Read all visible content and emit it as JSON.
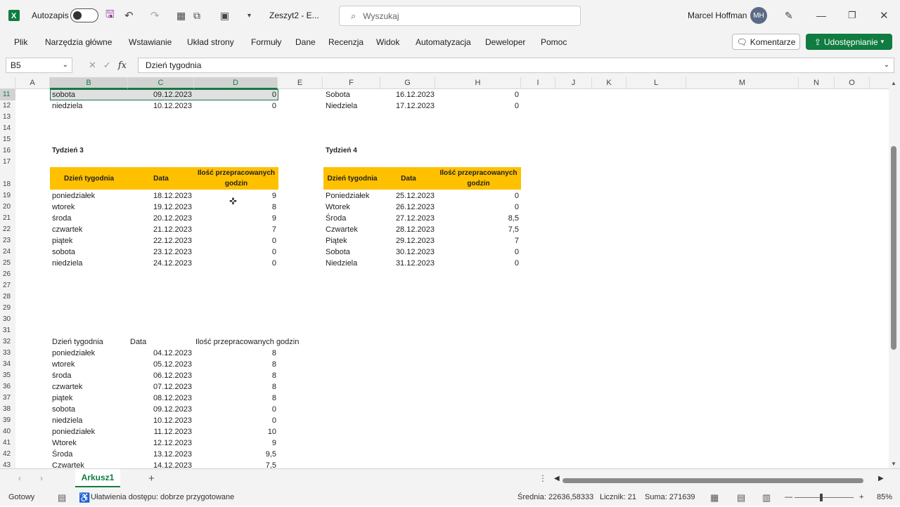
{
  "titlebar": {
    "autosave": "Autozapis",
    "filename": "Zeszyt2 - E...",
    "search_placeholder": "Wyszukaj",
    "user": "Marcel Hoffman",
    "initials": "MH"
  },
  "menu": [
    "Plik",
    "Narzędzia główne",
    "Wstawianie",
    "Układ strony",
    "Formuły",
    "Dane",
    "Recenzja",
    "Widok",
    "Automatyzacja",
    "Deweloper",
    "Pomoc"
  ],
  "buttons": {
    "comments": "Komentarze",
    "share": "Udostępnianie"
  },
  "formula": {
    "namebox": "B5",
    "fx": "fx",
    "value": "Dzień tygodnia"
  },
  "columns": [
    "A",
    "B",
    "C",
    "D",
    "E",
    "F",
    "G",
    "H",
    "I",
    "J",
    "K",
    "L",
    "M",
    "N",
    "O"
  ],
  "rows": [
    "11",
    "12",
    "13",
    "14",
    "15",
    "16",
    "17",
    "18",
    "19",
    "20",
    "21",
    "22",
    "23",
    "24",
    "25",
    "26",
    "27",
    "28",
    "29",
    "30",
    "31",
    "32",
    "33",
    "34",
    "35",
    "36",
    "37",
    "38",
    "39",
    "40",
    "41",
    "42",
    "43"
  ],
  "top_rows": {
    "left": [
      [
        "sobota",
        "09.12.2023",
        "0"
      ],
      [
        "niedziela",
        "10.12.2023",
        "0"
      ]
    ],
    "right": [
      [
        "Sobota",
        "16.12.2023",
        "0"
      ],
      [
        "Niedziela",
        "17.12.2023",
        "0"
      ]
    ]
  },
  "week3": {
    "title": "Tydzień 3",
    "headers": [
      "Dzień tygodnia",
      "Data",
      "Ilość przepracowanych godzin"
    ],
    "rows": [
      [
        "poniedziałek",
        "18.12.2023",
        "9"
      ],
      [
        "wtorek",
        "19.12.2023",
        "8"
      ],
      [
        "środa",
        "20.12.2023",
        "9"
      ],
      [
        "czwartek",
        "21.12.2023",
        "7"
      ],
      [
        "piątek",
        "22.12.2023",
        "0"
      ],
      [
        "sobota",
        "23.12.2023",
        "0"
      ],
      [
        "niedziela",
        "24.12.2023",
        "0"
      ]
    ]
  },
  "week4": {
    "title": "Tydzień 4",
    "headers": [
      "Dzień tygodnia",
      "Data",
      "Ilość przepracowanych godzin"
    ],
    "rows": [
      [
        "Poniedziałek",
        "25.12.2023",
        "0"
      ],
      [
        "Wtorek",
        "26.12.2023",
        "0"
      ],
      [
        "Środa",
        "27.12.2023",
        "8,5"
      ],
      [
        "Czwartek",
        "28.12.2023",
        "7,5"
      ],
      [
        "Piątek",
        "29.12.2023",
        "7"
      ],
      [
        "Sobota",
        "30.12.2023",
        "0"
      ],
      [
        "Niedziela",
        "31.12.2023",
        "0"
      ]
    ]
  },
  "summary": {
    "headers": [
      "Dzień tygodnia",
      "Data",
      "Ilość przepracowanych godzin"
    ],
    "rows": [
      [
        "poniedziałek",
        "04.12.2023",
        "8"
      ],
      [
        "wtorek",
        "05.12.2023",
        "8"
      ],
      [
        "środa",
        "06.12.2023",
        "8"
      ],
      [
        "czwartek",
        "07.12.2023",
        "8"
      ],
      [
        "piątek",
        "08.12.2023",
        "8"
      ],
      [
        "sobota",
        "09.12.2023",
        "0"
      ],
      [
        "niedziela",
        "10.12.2023",
        "0"
      ],
      [
        "poniedziałek",
        "11.12.2023",
        "10"
      ],
      [
        "Wtorek",
        "12.12.2023",
        "9"
      ],
      [
        "Środa",
        "13.12.2023",
        "9,5"
      ],
      [
        "Czwartek",
        "14.12.2023",
        "7,5"
      ]
    ]
  },
  "sheet": {
    "tab": "Arkusz1"
  },
  "status": {
    "ready": "Gotowy",
    "accessibility": "Ułatwienia dostępu: dobrze przygotowane",
    "average": "Średnia: 22636,58333",
    "count": "Licznik: 21",
    "sum": "Suma: 271639",
    "zoom": "85%"
  },
  "colors": {
    "accent": "#107c41",
    "header_fill": "#ffc000"
  }
}
